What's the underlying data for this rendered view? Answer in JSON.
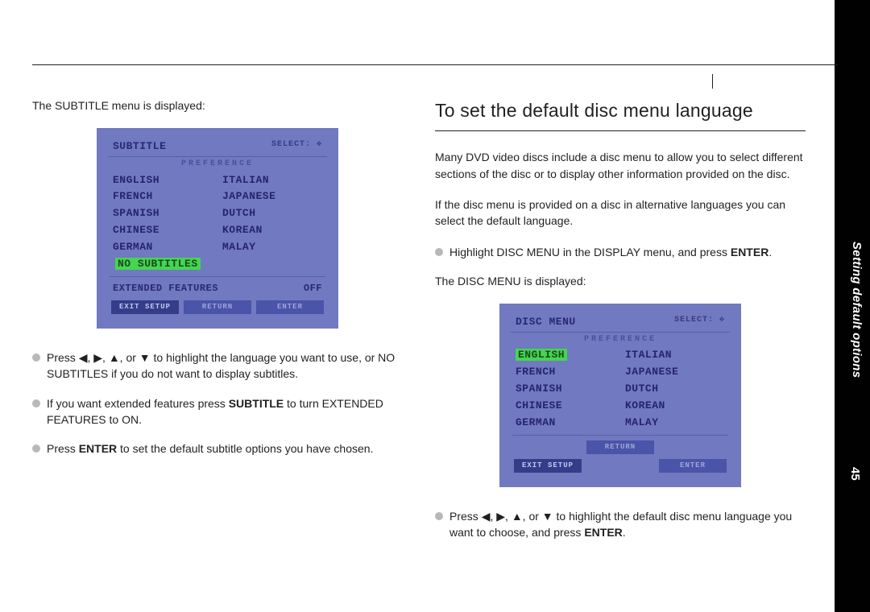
{
  "page_number": "45",
  "side_tab_text": "Setting default options",
  "left": {
    "intro": "The SUBTITLE menu is displayed:",
    "osd": {
      "title": "SUBTITLE",
      "select_label": "SELECT:",
      "pref_label": "PREFERENCE",
      "col1": [
        "ENGLISH",
        "FRENCH",
        "SPANISH",
        "CHINESE",
        "GERMAN"
      ],
      "col2": [
        "ITALIAN",
        "JAPANESE",
        "DUTCH",
        "KOREAN",
        "MALAY"
      ],
      "highlight_row": "NO SUBTITLES",
      "ext_label": "EXTENDED FEATURES",
      "ext_value": "OFF",
      "btn_left": "EXIT SETUP",
      "btn_mid": "RETURN",
      "btn_right": "ENTER"
    },
    "b1_pre": "Press ",
    "b1_post": " to highlight the language you want to use, or NO SUBTITLES if you do not want to display subtitles.",
    "b2_pre": "If you want extended features press ",
    "b2_bold": "SUBTITLE",
    "b2_post": " to turn EXTENDED FEATURES to ON.",
    "b3_pre": "Press ",
    "b3_bold": "ENTER",
    "b3_post": " to set the default subtitle options you have chosen."
  },
  "right": {
    "heading": "To set the default disc menu language",
    "p1": "Many DVD video discs include a disc menu to allow you to select different sections of the disc or to display other information provided on the disc.",
    "p2": "If the disc menu is provided on a disc in alternative languages you can select the default language.",
    "b1_pre": "Highlight DISC MENU in the DISPLAY menu, and press ",
    "b1_bold": "ENTER",
    "b1_post": ".",
    "intro2": "The DISC MENU is displayed:",
    "osd": {
      "title": "DISC MENU",
      "select_label": "SELECT:",
      "pref_label": "PREFERENCE",
      "highlight": "ENGLISH",
      "col1_rest": [
        "FRENCH",
        "SPANISH",
        "CHINESE",
        "GERMAN"
      ],
      "col2": [
        "ITALIAN",
        "JAPANESE",
        "DUTCH",
        "KOREAN",
        "MALAY"
      ],
      "btn_left": "EXIT SETUP",
      "btn_mid": "RETURN",
      "btn_right": "ENTER"
    },
    "b2_pre": "Press ",
    "b2_post": " to highlight the default disc menu language you want to choose, and press ",
    "b2_bold": "ENTER",
    "b2_end": "."
  },
  "arrow_sep": ", ",
  "arrow_or": ", or "
}
